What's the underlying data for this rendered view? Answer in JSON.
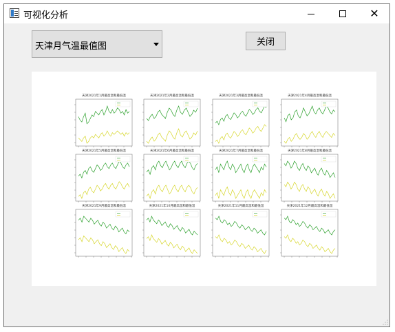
{
  "window": {
    "title": "可视化分析"
  },
  "controls": {
    "dropdown_value": "天津月气温最值图",
    "close_button": "关闭"
  },
  "icons": {
    "app": "window-app-icon",
    "minimize": "minimize-icon",
    "maximize": "maximize-icon",
    "close": "close-icon",
    "dropdown": "chevron-down-icon",
    "resize": "resize-grip-icon"
  },
  "colors": {
    "high_temp": "#2ca02c",
    "low_temp": "#d6d62a"
  },
  "chart_data": {
    "type": "line",
    "panels": [
      {
        "title": "天津2021年1月最高温和最低温",
        "high": [
          6,
          4,
          3,
          6,
          8,
          2,
          3,
          5,
          7,
          6,
          9,
          8,
          7,
          9,
          10,
          7,
          9,
          12,
          9,
          8,
          10,
          8,
          9,
          11,
          10,
          8,
          9,
          7,
          10,
          8,
          9
        ],
        "low": [
          -6,
          -7,
          -8,
          -6,
          -5,
          -9,
          -8,
          -6,
          -5,
          -6,
          -4,
          -5,
          -6,
          -4,
          -3,
          -5,
          -4,
          -2,
          -4,
          -5,
          -3,
          -4,
          -3,
          -2,
          -3,
          -4,
          -3,
          -5,
          -3,
          -4,
          -3
        ]
      },
      {
        "title": "天津2021年2月最高温和最低温",
        "high": [
          8,
          7,
          9,
          10,
          8,
          9,
          11,
          12,
          10,
          9,
          8,
          11,
          13,
          12,
          10,
          9,
          12,
          14,
          11,
          10,
          12,
          13,
          11,
          9,
          10,
          12,
          11,
          13
        ],
        "low": [
          -3,
          -4,
          -2,
          -1,
          -3,
          -2,
          0,
          1,
          -1,
          -2,
          -3,
          0,
          2,
          1,
          -1,
          -2,
          1,
          3,
          0,
          -1,
          1,
          2,
          0,
          -2,
          -1,
          1,
          0,
          2
        ]
      },
      {
        "title": "天津2021年3月最高温和最低温",
        "high": [
          12,
          13,
          11,
          14,
          15,
          13,
          16,
          17,
          15,
          14,
          16,
          18,
          17,
          15,
          16,
          18,
          19,
          17,
          16,
          18,
          20,
          19,
          17,
          18,
          20,
          21,
          19,
          18,
          20,
          22,
          21
        ],
        "low": [
          1,
          2,
          0,
          3,
          4,
          2,
          5,
          6,
          4,
          3,
          5,
          7,
          6,
          4,
          5,
          7,
          8,
          6,
          5,
          7,
          9,
          8,
          6,
          7,
          9,
          10,
          8,
          7,
          9,
          11,
          10
        ]
      },
      {
        "title": "天津2021年4月最高温和最低温",
        "high": [
          20,
          18,
          21,
          22,
          19,
          20,
          23,
          24,
          21,
          20,
          22,
          25,
          23,
          21,
          22,
          24,
          26,
          23,
          22,
          24,
          25,
          23,
          22,
          24,
          26,
          25,
          23,
          22,
          24,
          23
        ],
        "low": [
          8,
          7,
          9,
          10,
          8,
          9,
          11,
          12,
          10,
          9,
          10,
          12,
          11,
          9,
          10,
          12,
          13,
          11,
          10,
          12,
          13,
          11,
          10,
          12,
          13,
          12,
          11,
          10,
          12,
          11
        ]
      },
      {
        "title": "天津2021年5月最高温和最低温",
        "high": [
          24,
          25,
          23,
          26,
          27,
          25,
          28,
          29,
          27,
          26,
          28,
          30,
          29,
          27,
          28,
          30,
          31,
          29,
          28,
          30,
          31,
          29,
          28,
          30,
          32,
          31,
          29,
          28,
          30,
          31,
          29
        ],
        "low": [
          13,
          14,
          12,
          15,
          16,
          14,
          17,
          18,
          16,
          15,
          17,
          19,
          18,
          16,
          17,
          19,
          20,
          18,
          17,
          19,
          20,
          18,
          17,
          19,
          21,
          20,
          18,
          17,
          19,
          20,
          18
        ]
      },
      {
        "title": "天津2021年6月最高温和最低温",
        "high": [
          30,
          31,
          29,
          32,
          33,
          31,
          34,
          35,
          33,
          32,
          34,
          35,
          33,
          31,
          32,
          34,
          35,
          33,
          32,
          34,
          35,
          33,
          32,
          34,
          35,
          34,
          32,
          31,
          33,
          34
        ],
        "low": [
          19,
          20,
          18,
          21,
          22,
          20,
          23,
          24,
          22,
          21,
          23,
          24,
          22,
          20,
          21,
          23,
          24,
          22,
          21,
          23,
          24,
          22,
          21,
          23,
          24,
          23,
          21,
          20,
          22,
          23
        ]
      },
      {
        "title": "天津2021年7月最高温和最低温",
        "high": [
          33,
          34,
          32,
          35,
          34,
          33,
          35,
          36,
          34,
          33,
          35,
          34,
          32,
          33,
          34,
          35,
          33,
          32,
          34,
          35,
          33,
          32,
          34,
          35,
          34,
          33,
          32,
          34,
          33,
          35,
          34
        ],
        "low": [
          24,
          25,
          23,
          26,
          25,
          24,
          26,
          27,
          25,
          24,
          26,
          25,
          23,
          24,
          25,
          26,
          24,
          23,
          25,
          26,
          24,
          23,
          25,
          26,
          25,
          24,
          23,
          25,
          24,
          26,
          25
        ]
      },
      {
        "title": "天津2021年8月最高温和最低温",
        "high": [
          33,
          32,
          34,
          33,
          31,
          32,
          34,
          33,
          31,
          30,
          32,
          33,
          31,
          30,
          32,
          31,
          29,
          30,
          31,
          29,
          28,
          30,
          31,
          29,
          28,
          30,
          29,
          27,
          28,
          29,
          27
        ],
        "low": [
          24,
          23,
          25,
          24,
          22,
          23,
          25,
          24,
          22,
          21,
          23,
          24,
          22,
          21,
          23,
          22,
          20,
          21,
          22,
          20,
          19,
          21,
          22,
          20,
          19,
          21,
          20,
          18,
          19,
          20,
          18
        ]
      },
      {
        "title": "天津2021年9月最高温和最低温",
        "high": [
          28,
          29,
          27,
          30,
          29,
          28,
          27,
          29,
          28,
          26,
          27,
          28,
          26,
          25,
          27,
          26,
          24,
          25,
          26,
          24,
          23,
          25,
          24,
          22,
          23,
          24,
          22,
          21,
          23,
          22
        ],
        "low": [
          18,
          19,
          17,
          20,
          19,
          18,
          17,
          19,
          18,
          16,
          17,
          18,
          16,
          15,
          17,
          16,
          14,
          15,
          16,
          14,
          13,
          15,
          14,
          12,
          13,
          14,
          12,
          11,
          13,
          12
        ]
      },
      {
        "title": "天津2021年10月最高温和最低温",
        "high": [
          22,
          23,
          21,
          24,
          22,
          21,
          20,
          22,
          21,
          19,
          20,
          21,
          19,
          18,
          20,
          19,
          17,
          18,
          19,
          17,
          16,
          18,
          17,
          15,
          16,
          17,
          15,
          14,
          16,
          15,
          14
        ],
        "low": [
          12,
          13,
          11,
          14,
          12,
          11,
          10,
          12,
          11,
          9,
          10,
          11,
          9,
          8,
          10,
          9,
          7,
          8,
          9,
          7,
          6,
          8,
          7,
          5,
          6,
          7,
          5,
          4,
          6,
          5,
          4
        ]
      },
      {
        "title": "天津2021年11月最高温和最低温",
        "high": [
          15,
          14,
          16,
          13,
          12,
          14,
          13,
          11,
          12,
          10,
          11,
          13,
          12,
          10,
          9,
          11,
          10,
          8,
          9,
          10,
          8,
          7,
          9,
          8,
          6,
          7,
          8,
          6,
          5,
          7
        ],
        "low": [
          4,
          3,
          5,
          2,
          1,
          3,
          2,
          0,
          1,
          -1,
          0,
          2,
          1,
          -1,
          -2,
          0,
          -1,
          -3,
          -2,
          -1,
          -3,
          -4,
          -2,
          -3,
          -5,
          -4,
          -3,
          -5,
          -6,
          -4
        ]
      },
      {
        "title": "天津2021年12月最高温和最低温",
        "high": [
          8,
          7,
          9,
          6,
          5,
          7,
          6,
          4,
          5,
          3,
          4,
          6,
          5,
          3,
          2,
          4,
          3,
          1,
          2,
          3,
          1,
          0,
          2,
          1,
          -1,
          0,
          1,
          -1,
          -2,
          0,
          1
        ],
        "low": [
          -3,
          -4,
          -2,
          -5,
          -6,
          -4,
          -5,
          -7,
          -6,
          -8,
          -7,
          -5,
          -6,
          -8,
          -9,
          -7,
          -8,
          -10,
          -9,
          -8,
          -10,
          -11,
          -9,
          -10,
          -12,
          -11,
          -10,
          -12,
          -13,
          -11,
          -10
        ]
      }
    ]
  }
}
